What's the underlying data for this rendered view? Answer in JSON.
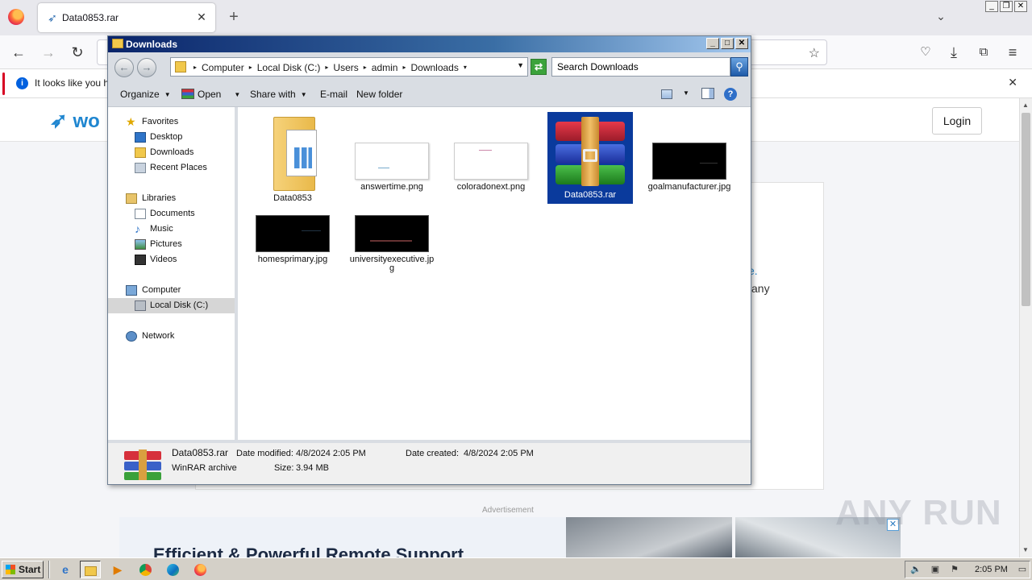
{
  "browser": {
    "tab_title": "Data0853.rar",
    "notice_text": "It looks like you ha",
    "new_tab": "+",
    "close": "✕"
  },
  "page": {
    "logo_text": "wo",
    "login_label": "Login",
    "link_fragment": "e.",
    "text_fragment": "any",
    "ad_label": "Advertisement",
    "ad_headline": "Efficient & Powerful Remote Support",
    "watermark": "ANY RUN"
  },
  "explorer": {
    "title": "Downloads",
    "breadcrumbs": [
      "Computer",
      "Local Disk (C:)",
      "Users",
      "admin",
      "Downloads"
    ],
    "search_placeholder": "Search Downloads",
    "toolbar": {
      "organize": "Organize",
      "open": "Open",
      "share_with": "Share with",
      "email": "E-mail",
      "new_folder": "New folder"
    },
    "nav": {
      "favorites": "Favorites",
      "desktop": "Desktop",
      "downloads": "Downloads",
      "recent_places": "Recent Places",
      "libraries": "Libraries",
      "documents": "Documents",
      "music": "Music",
      "pictures": "Pictures",
      "videos": "Videos",
      "computer": "Computer",
      "local_disk": "Local Disk (C:)",
      "network": "Network"
    },
    "files": [
      {
        "name": "Data0853",
        "type": "folder"
      },
      {
        "name": "answertime.png",
        "type": "image-white"
      },
      {
        "name": "coloradonext.png",
        "type": "image-white"
      },
      {
        "name": "Data0853.rar",
        "type": "winrar",
        "selected": true
      },
      {
        "name": "goalmanufacturer.jpg",
        "type": "image-black"
      },
      {
        "name": "homesprimary.jpg",
        "type": "image-black"
      },
      {
        "name": "universityexecutive.jpg",
        "type": "image-black"
      }
    ],
    "status": {
      "name": "Data0853.rar",
      "type": "WinRAR archive",
      "modified_label": "Date modified:",
      "modified": "4/8/2024 2:05 PM",
      "created_label": "Date created:",
      "created": "4/8/2024 2:05 PM",
      "size_label": "Size:",
      "size": "3.94 MB"
    }
  },
  "taskbar": {
    "start_label": "Start",
    "clock": "2:05 PM"
  }
}
